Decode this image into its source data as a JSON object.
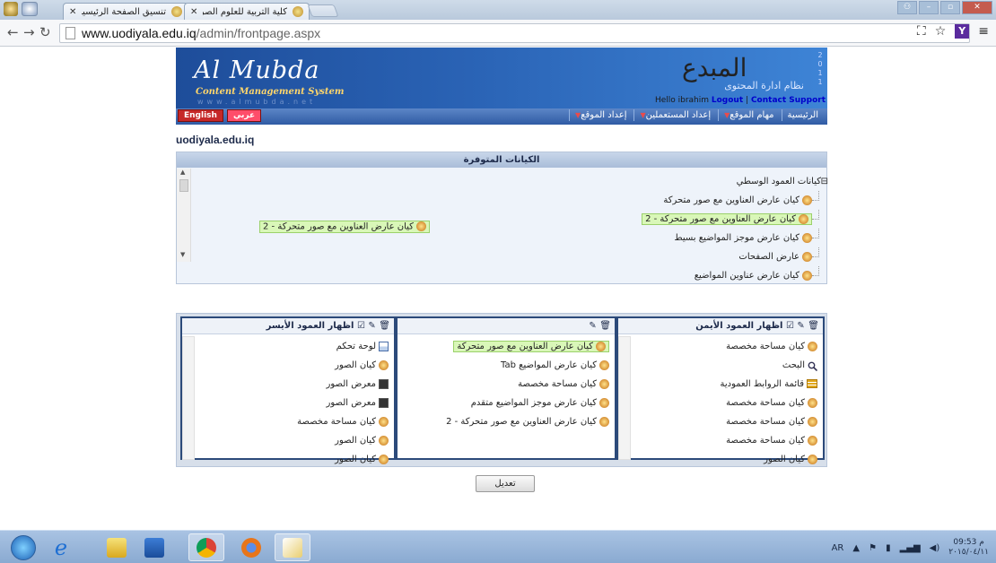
{
  "browser": {
    "tabs": [
      {
        "title": "تنسيق الصفحة الرئيسية"
      },
      {
        "title": "كلية التربية للعلوم الصرفة"
      }
    ],
    "url_host": "www.uodiyala.edu.iq",
    "url_path": "/admin/frontpage.aspx"
  },
  "banner": {
    "brand": "Al Mubda",
    "subtitle": "Content Management System",
    "site_url": "www.almubda.net",
    "logo_text": "المبدع",
    "tagline": "نظام ادارة المحتوى",
    "year_digits": [
      "2",
      "0",
      "1",
      "1"
    ],
    "greeting": "Hello ibrahim",
    "logout": "Logout",
    "support": "Contact Support"
  },
  "menu": {
    "items": [
      {
        "label": "الرئيسية",
        "has_caret": false
      },
      {
        "label": "مهام الموقع",
        "has_caret": true
      },
      {
        "label": "إعداد المستعملين",
        "has_caret": true
      },
      {
        "label": "إعداد الموقع",
        "has_caret": true
      }
    ],
    "lang_ar": "عربي",
    "lang_en": "English"
  },
  "site_name": "uodiyala.edu.iq",
  "available": {
    "title": "الكيانات المتوفرة",
    "root": "كيانات العمود الوسطي",
    "items": [
      "كيان عارض العناوين مع صور متحركة",
      "كيان عارض العناوين مع صور متحركة - 2",
      "كيان عارض موجز المواضيع بسيط",
      "عارض الصفحات",
      "كيان عارض عناوين المواضيع"
    ],
    "selected_index": 1,
    "dragged": "كيان عارض العناوين مع صور متحركة - 2"
  },
  "columns": {
    "right": {
      "title": "اظهار العمود الأيمن",
      "items": [
        {
          "label": "كيان مساحة مخصصة",
          "icon": "component-icon"
        },
        {
          "label": "البحث",
          "icon": "search-icon"
        },
        {
          "label": "قائمة الروابط العمودية",
          "icon": "list-icon"
        },
        {
          "label": "كيان مساحة مخصصة",
          "icon": "component-icon"
        },
        {
          "label": "كيان مساحة مخصصة",
          "icon": "component-icon"
        },
        {
          "label": "كيان مساحة مخصصة",
          "icon": "component-icon"
        },
        {
          "label": "كيان الصور",
          "icon": "component-icon"
        }
      ]
    },
    "middle": {
      "items": [
        {
          "label": "كيان عارض العناوين مع صور متحركة",
          "icon": "component-icon",
          "highlight": true
        },
        {
          "label": "كيان عارض المواضيع Tab",
          "icon": "component-icon",
          "highlight": false
        },
        {
          "label": "كيان مساحة مخصصة",
          "icon": "component-icon",
          "highlight": false
        },
        {
          "label": "كيان عارض موجز المواضيع متقدم",
          "icon": "component-icon",
          "highlight": false
        },
        {
          "label": "كيان عارض العناوين مع صور متحركة - 2",
          "icon": "component-icon",
          "highlight": false
        }
      ]
    },
    "left": {
      "title": "اظهار العمود الأيسر",
      "items": [
        {
          "label": "لوحة تحكم",
          "icon": "panel-icon"
        },
        {
          "label": "كيان الصور",
          "icon": "component-icon"
        },
        {
          "label": "معرض الصور",
          "icon": "camera-icon"
        },
        {
          "label": "معرض الصور",
          "icon": "camera-icon"
        },
        {
          "label": "كيان مساحة مخصصة",
          "icon": "component-icon"
        },
        {
          "label": "كيان الصور",
          "icon": "component-icon"
        },
        {
          "label": "كيان الصور",
          "icon": "component-icon"
        }
      ]
    }
  },
  "save_button": "تعديل",
  "taskbar": {
    "apps": [
      "start",
      "internet-explorer",
      "file-explorer",
      "outlook",
      "chrome",
      "firefox",
      "paint"
    ],
    "lang": "AR",
    "time": "09:53 م",
    "date": "٢٠١٥/٠٤/١١"
  },
  "colors": {
    "banner": "#2a63b5",
    "menu": "#2f5ba4",
    "highlight": "#d9f7b8",
    "column_border": "#2c4a7a"
  }
}
